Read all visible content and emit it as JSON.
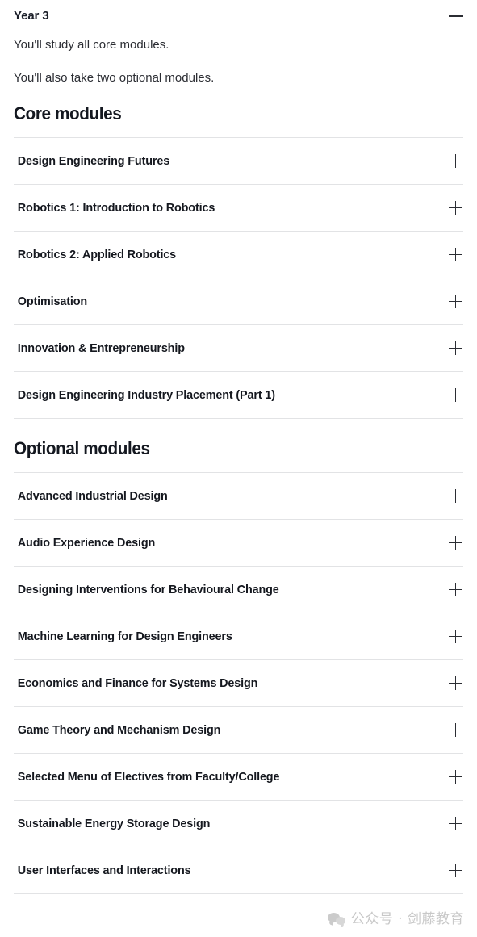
{
  "accordion": {
    "title": "Year 3",
    "toggle_icon": "minus-icon",
    "expanded": true
  },
  "intro": {
    "paragraphs": [
      "You'll study all core modules.",
      "You'll also take two optional modules."
    ]
  },
  "sections": [
    {
      "heading": "Core modules",
      "items": [
        {
          "title": "Design Engineering Futures",
          "icon": "plus-icon"
        },
        {
          "title": "Robotics 1: Introduction to Robotics",
          "icon": "plus-icon"
        },
        {
          "title": "Robotics 2: Applied Robotics",
          "icon": "plus-icon"
        },
        {
          "title": "Optimisation",
          "icon": "plus-icon"
        },
        {
          "title": "Innovation & Entrepreneurship",
          "icon": "plus-icon"
        },
        {
          "title": "Design Engineering Industry Placement (Part 1)",
          "icon": "plus-icon"
        }
      ]
    },
    {
      "heading": "Optional modules",
      "items": [
        {
          "title": "Advanced Industrial Design",
          "icon": "plus-icon"
        },
        {
          "title": "Audio Experience Design",
          "icon": "plus-icon"
        },
        {
          "title": "Designing Interventions for Behavioural Change",
          "icon": "plus-icon"
        },
        {
          "title": "Machine Learning for Design Engineers",
          "icon": "plus-icon"
        },
        {
          "title": "Economics and Finance for Systems Design",
          "icon": "plus-icon"
        },
        {
          "title": "Game Theory and Mechanism Design",
          "icon": "plus-icon"
        },
        {
          "title": "Selected Menu of Electives from Faculty/College",
          "icon": "plus-icon"
        },
        {
          "title": "Sustainable Energy Storage Design",
          "icon": "plus-icon"
        },
        {
          "title": "User Interfaces and Interactions",
          "icon": "plus-icon"
        }
      ]
    }
  ],
  "watermark": {
    "icon": "wechat-icon",
    "text": "公众号 · 剑藤教育"
  },
  "colors": {
    "text": "#2b2d33",
    "heading": "#141820",
    "separator": "#e2e3e5",
    "background": "#ffffff",
    "watermark": "#c6c6c6"
  }
}
